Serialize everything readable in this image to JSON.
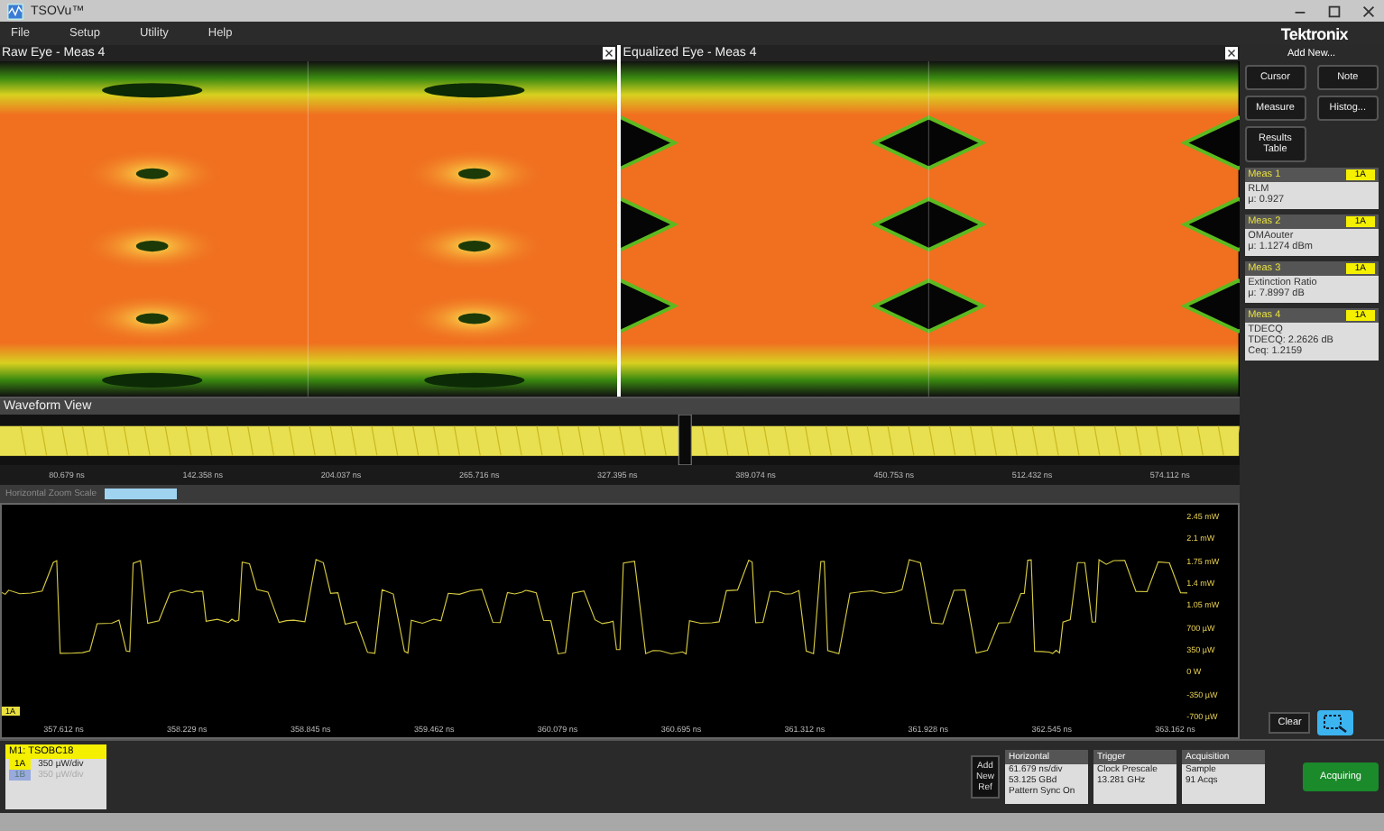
{
  "window": {
    "title": "TSOVu™"
  },
  "menu": [
    "File",
    "Setup",
    "Utility",
    "Help"
  ],
  "logo": "Tektronix",
  "eye_panels": [
    {
      "title": "Raw Eye - Meas 4",
      "kind": "raw"
    },
    {
      "title": "Equalized Eye - Meas 4",
      "kind": "equalized"
    }
  ],
  "waveform_view": {
    "title": "Waveform View",
    "ticks": [
      "80.679 ns",
      "142.358 ns",
      "204.037 ns",
      "265.716 ns",
      "327.395 ns",
      "389.074 ns",
      "450.753 ns",
      "512.432 ns",
      "574.112 ns"
    ]
  },
  "zoom_bar": {
    "label": "Horizontal Zoom Scale"
  },
  "zoom_plot": {
    "y_ticks": [
      "2.45 mW",
      "2.1 mW",
      "1.75 mW",
      "1.4 mW",
      "1.05 mW",
      "700 µW",
      "350 µW",
      "0 W",
      "-350 µW",
      "-700 µW"
    ],
    "x_ticks": [
      "357.612 ns",
      "358.229 ns",
      "358.845 ns",
      "359.462 ns",
      "360.079 ns",
      "360.695 ns",
      "361.312 ns",
      "361.928 ns",
      "362.545 ns",
      "363.162 ns"
    ],
    "marker": "1A"
  },
  "side_panel": {
    "heading": "Add New...",
    "buttons": [
      "Cursor",
      "Note",
      "Measure",
      "Histog...",
      "Results Table"
    ],
    "measurements": [
      {
        "title": "Meas 1",
        "badge": "1A",
        "lines": [
          "RLM",
          "μ: 0.927"
        ]
      },
      {
        "title": "Meas 2",
        "badge": "1A",
        "lines": [
          "OMAouter",
          "μ: 1.1274 dBm"
        ]
      },
      {
        "title": "Meas 3",
        "badge": "1A",
        "lines": [
          "Extinction Ratio",
          "μ: 7.8997 dB"
        ]
      },
      {
        "title": "Meas 4",
        "badge": "1A",
        "lines": [
          "TDECQ",
          "TDECQ: 2.2626 dB",
          "Ceq: 1.2159"
        ]
      }
    ],
    "clear": "Clear"
  },
  "bottom_bar": {
    "channel": {
      "title": "M1: TSOBC18",
      "rows": [
        {
          "label": "1A",
          "value": "350 µW/div",
          "disabled": false
        },
        {
          "label": "1B",
          "value": "350 µW/div",
          "disabled": true
        }
      ]
    },
    "add_ref": "Add New Ref",
    "groups": [
      {
        "title": "Horizontal",
        "lines": [
          "61.679 ns/div",
          "53.125 GBd",
          "Pattern Sync On"
        ]
      },
      {
        "title": "Trigger",
        "lines": [
          "Clock Prescale",
          "13.281 GHz"
        ]
      },
      {
        "title": "Acquisition",
        "lines": [
          "Sample",
          "91 Acqs"
        ]
      }
    ],
    "acquire": "Acquiring"
  }
}
